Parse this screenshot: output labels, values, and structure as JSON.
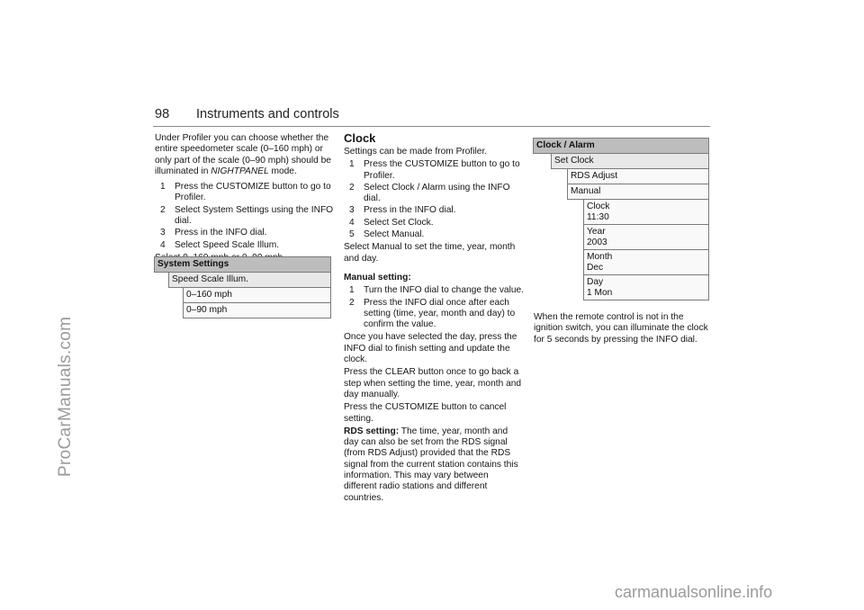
{
  "header": {
    "page_number": "98",
    "title": "Instruments and controls"
  },
  "column1": {
    "intro_parts": [
      "Under Profiler you can choose whether the entire speedometer scale (0–160 mph) or only part of the scale (0–90 mph) should be illuminated in ",
      "NIGHTPANEL",
      " mode."
    ],
    "steps": [
      {
        "n": "1",
        "text": "Press the CUSTOMIZE button to go to Profiler."
      },
      {
        "n": "2",
        "text": "Select System Settings using the INFO dial."
      },
      {
        "n": "3",
        "text": "Press in the INFO dial."
      },
      {
        "n": "4",
        "text": "Select Speed Scale Illum."
      }
    ],
    "outro": "Select 0–160 mph or 0–90 mph.",
    "menu": {
      "header": "System Settings",
      "level1": "Speed Scale Illum.",
      "options": [
        "0–160 mph",
        "0–90 mph"
      ]
    }
  },
  "column2": {
    "title": "Clock",
    "intro": "Settings can be made from Profiler.",
    "steps": [
      {
        "n": "1",
        "text": "Press the CUSTOMIZE button to go to Profiler."
      },
      {
        "n": "2",
        "text": "Select Clock / Alarm using the INFO dial."
      },
      {
        "n": "3",
        "text": "Press in the INFO dial."
      },
      {
        "n": "4",
        "text": "Select Set Clock."
      },
      {
        "n": "5",
        "text": "Select Manual."
      }
    ],
    "manual_note": "Select Manual to set the time, year, month and day.",
    "manual_heading": "Manual setting:",
    "manual_steps": [
      {
        "n": "1",
        "text": "Turn the INFO dial to change the value."
      },
      {
        "n": "2",
        "text": "Press the INFO dial once after each setting (time, year, month and day) to confirm the value."
      }
    ],
    "para_finish": "Once you have selected the day, press the INFO dial to finish setting and update the clock.",
    "para_clear": "Press the CLEAR button once to go back a step when setting the time, year, month and day manually.",
    "para_cancel": "Press the CUSTOMIZE button to cancel setting.",
    "rds_label": "RDS setting:",
    "rds_text": " The time, year, month and day can also be set from the RDS signal (from RDS Adjust) provided that the RDS signal from the current station contains this information. This may vary between different radio stations and different countries."
  },
  "column3": {
    "menu": {
      "header": "Clock / Alarm",
      "level1": "Set Clock",
      "level2": [
        "RDS Adjust",
        "Manual"
      ],
      "level3": [
        {
          "label": "Clock",
          "value": "11:30"
        },
        {
          "label": "Year",
          "value": "2003"
        },
        {
          "label": "Month",
          "value": "Dec"
        },
        {
          "label": "Day",
          "value": "1 Mon"
        }
      ]
    },
    "note": "When the remote control is not in the ignition switch, you can illuminate the clock for 5 seconds by pressing the INFO dial."
  },
  "watermarks": {
    "side": "ProCarManuals.com",
    "bottom": "carmanualsonline.info"
  },
  "colors": {
    "menu_header_bg": "#bdbdbd",
    "menu_level1_bg": "#e8e8e8",
    "menu_level2_bg": "#f9f9f9",
    "watermark": "#9a9a9a"
  }
}
